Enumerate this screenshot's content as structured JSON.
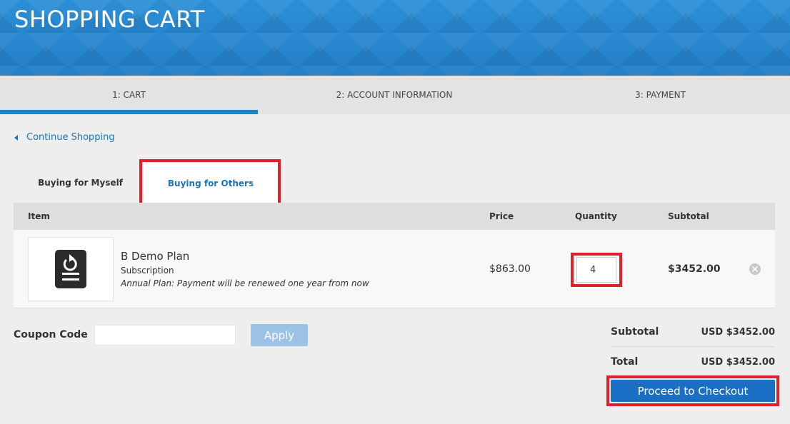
{
  "header": {
    "title": "SHOPPING CART"
  },
  "steps": [
    {
      "label": "1: CART"
    },
    {
      "label": "2: ACCOUNT INFORMATION"
    },
    {
      "label": "3: PAYMENT"
    }
  ],
  "continue_label": "Continue Shopping",
  "tabs": [
    {
      "label": "Buying for Myself"
    },
    {
      "label": "Buying for Others"
    }
  ],
  "table": {
    "headers": {
      "item": "Item",
      "price": "Price",
      "quantity": "Quantity",
      "subtotal": "Subtotal"
    },
    "rows": [
      {
        "name": "B Demo Plan",
        "type": "Subscription",
        "note": "Annual Plan: Payment will be renewed one year from now",
        "price": "$863.00",
        "quantity": "4",
        "subtotal": "$3452.00",
        "icon": "renew-document-icon"
      }
    ]
  },
  "coupon": {
    "label": "Coupon Code",
    "value": "",
    "apply_label": "Apply"
  },
  "summary": {
    "subtotal_label": "Subtotal",
    "subtotal_value": "USD $3452.00",
    "total_label": "Total",
    "total_value": "USD $3452.00"
  },
  "checkout_label": "Proceed to Checkout",
  "colors": {
    "accent": "#1a84c7",
    "highlight": "#e0202a",
    "button": "#1a6fc4"
  }
}
